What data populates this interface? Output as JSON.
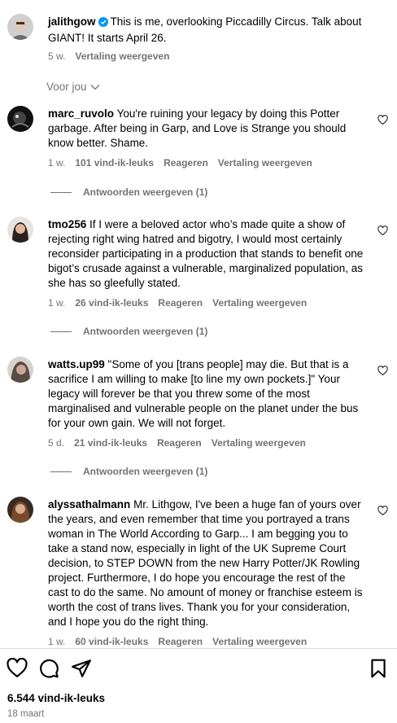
{
  "caption": {
    "username": "jalithgow",
    "text": "This is me, overlooking Piccadilly Circus. Talk about GIANT! It starts April 26.",
    "time": "5 w.",
    "translate": "Vertaling weergeven"
  },
  "sort_label": "Voor jou",
  "comments": [
    {
      "username": "marc_ruvolo",
      "text": "You're ruining your legacy by doing this Potter garbage. After being in Garp, and Love is Strange you should know better. Shame.",
      "time": "1 w.",
      "likes": "101 vind-ik-leuks",
      "reply": "Reageren",
      "translate": "Vertaling weergeven",
      "view_replies": "Antwoorden weergeven (1)"
    },
    {
      "username": "tmo256",
      "text": "If I were a beloved actor who’s made quite a show of rejecting right wing hatred and bigotry, I would most certainly reconsider participating in a production that stands to benefit one bigot’s crusade against a vulnerable, marginalized population, as she has so gleefully stated.",
      "time": "1 w.",
      "likes": "26 vind-ik-leuks",
      "reply": "Reageren",
      "translate": "Vertaling weergeven",
      "view_replies": "Antwoorden weergeven (1)"
    },
    {
      "username": "watts.up99",
      "text": "\"Some of you [trans people] may die. But that is a sacrifice I am willing to make [to line my own pockets.]\" Your legacy will forever be that you threw some of the most marginalised and vulnerable people on the planet under the bus for your own gain. We will not forget.",
      "time": "5 d.",
      "likes": "21 vind-ik-leuks",
      "reply": "Reageren",
      "translate": "Vertaling weergeven",
      "view_replies": "Antwoorden weergeven (1)"
    },
    {
      "username": "alyssathalmann",
      "text": "Mr. Lithgow, I've been a huge fan of yours over the years, and even remember that time you portrayed a trans woman in The World According to Garp... I am begging you to take a stand now, especially in light of the UK Supreme Court decision, to STEP DOWN from the new Harry Potter/JK Rowling project. Furthermore, I do hope you encourage the rest of the cast to do the same. No amount of money or franchise esteem is worth the cost of trans lives. Thank you for your consideration, and I hope you do the right thing.",
      "time": "1 w.",
      "likes": "60 vind-ik-leuks",
      "reply": "Reageren",
      "translate": "Vertaling weergeven"
    }
  ],
  "footer": {
    "likes": "6.544 vind-ik-leuks",
    "date": "18 maart"
  },
  "colors": {
    "text": "#000000",
    "secondary": "#737373",
    "verified": "#0095f6",
    "divider": "#dbdbdb"
  }
}
